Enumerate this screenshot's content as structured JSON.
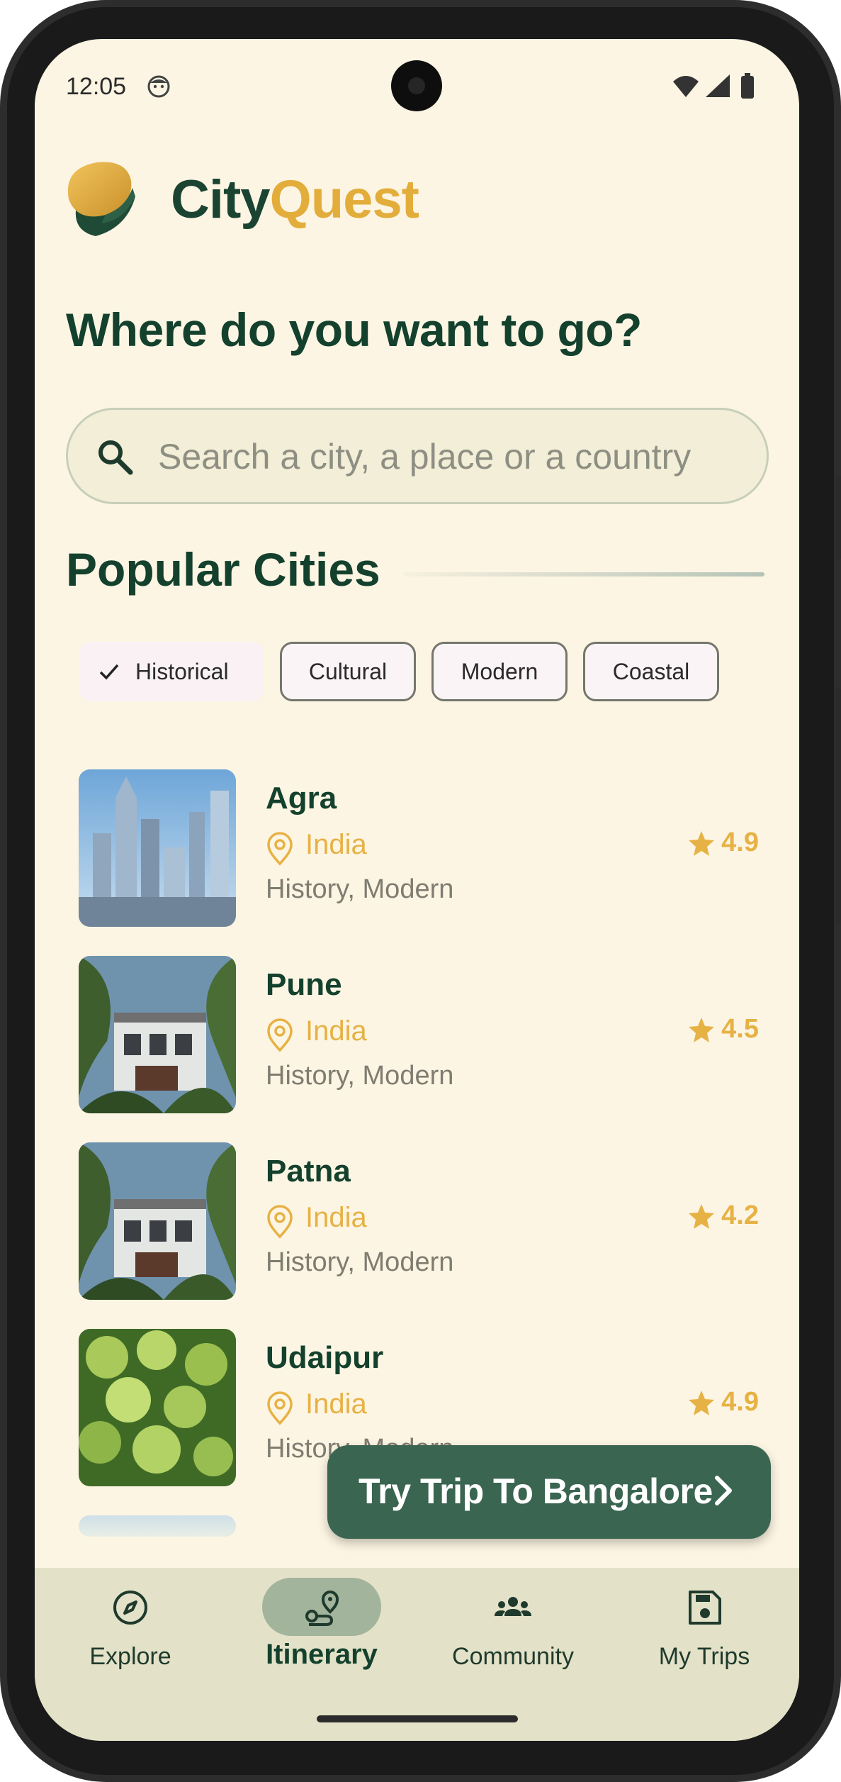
{
  "status_bar": {
    "time": "12:05"
  },
  "brand": {
    "part1": "City",
    "part2": "Quest"
  },
  "headline": "Where do you want to go?",
  "search": {
    "placeholder": "Search a city, a place or a country"
  },
  "section": {
    "title": "Popular Cities"
  },
  "chips": [
    {
      "label": "Historical",
      "selected": true
    },
    {
      "label": "Cultural",
      "selected": false
    },
    {
      "label": "Modern",
      "selected": false
    },
    {
      "label": "Coastal",
      "selected": false
    }
  ],
  "cities": [
    {
      "name": "Agra",
      "country": "India",
      "tags": "History, Modern",
      "rating": "4.9"
    },
    {
      "name": "Pune",
      "country": "India",
      "tags": "History, Modern",
      "rating": "4.5"
    },
    {
      "name": "Patna",
      "country": "India",
      "tags": "History, Modern",
      "rating": "4.2"
    },
    {
      "name": "Udaipur",
      "country": "India",
      "tags": "History, Modern",
      "rating": "4.9"
    }
  ],
  "cta": {
    "label": "Try Trip To Bangalore"
  },
  "nav": [
    {
      "label": "Explore",
      "icon": "compass-icon",
      "active": false
    },
    {
      "label": "Itinerary",
      "icon": "route-icon",
      "active": true
    },
    {
      "label": "Community",
      "icon": "groups-icon",
      "active": false
    },
    {
      "label": "My Trips",
      "icon": "save-icon",
      "active": false
    }
  ],
  "colors": {
    "background": "#fdf5e3",
    "primary": "#14412d",
    "accent": "#e3ad3b",
    "cta": "#3a6551",
    "nav_bg": "#e3e2c8"
  }
}
